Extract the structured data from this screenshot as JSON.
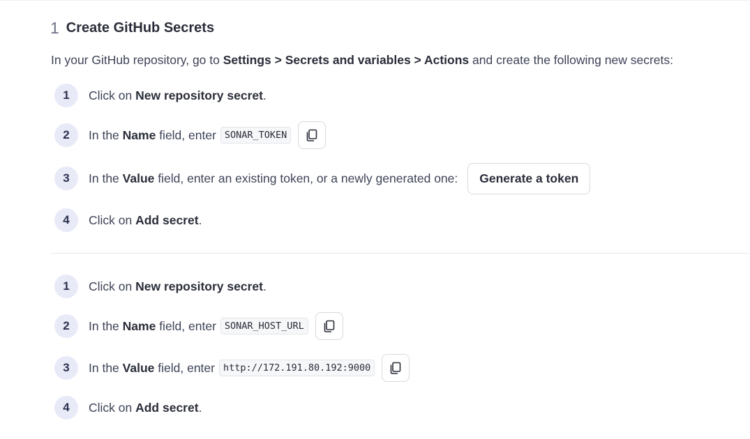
{
  "section": {
    "number": "1",
    "title": "Create GitHub Secrets"
  },
  "intro": {
    "prefix": "In your GitHub repository, go to ",
    "path": "Settings > Secrets and variables > Actions",
    "suffix": " and create the following new secrets:"
  },
  "group1": {
    "step1": {
      "num": "1",
      "pre": "Click on ",
      "bold": "New repository secret",
      "post": "."
    },
    "step2": {
      "num": "2",
      "pre": "In the ",
      "bold": "Name",
      "post": " field, enter",
      "code": "SONAR_TOKEN",
      "copy_icon": "copy-icon"
    },
    "step3": {
      "num": "3",
      "pre": "In the ",
      "bold": "Value",
      "post": " field, enter an existing token, or a newly generated one:",
      "button": "Generate a token"
    },
    "step4": {
      "num": "4",
      "pre": "Click on ",
      "bold": "Add secret",
      "post": "."
    }
  },
  "group2": {
    "step1": {
      "num": "1",
      "pre": "Click on ",
      "bold": "New repository secret",
      "post": "."
    },
    "step2": {
      "num": "2",
      "pre": "In the ",
      "bold": "Name",
      "post": " field, enter",
      "code": "SONAR_HOST_URL",
      "copy_icon": "copy-icon"
    },
    "step3": {
      "num": "3",
      "pre": "In the ",
      "bold": "Value",
      "post": " field, enter",
      "code": "http://172.191.80.192:9000",
      "copy_icon": "copy-icon"
    },
    "step4": {
      "num": "4",
      "pre": "Click on ",
      "bold": "Add secret",
      "post": "."
    }
  }
}
